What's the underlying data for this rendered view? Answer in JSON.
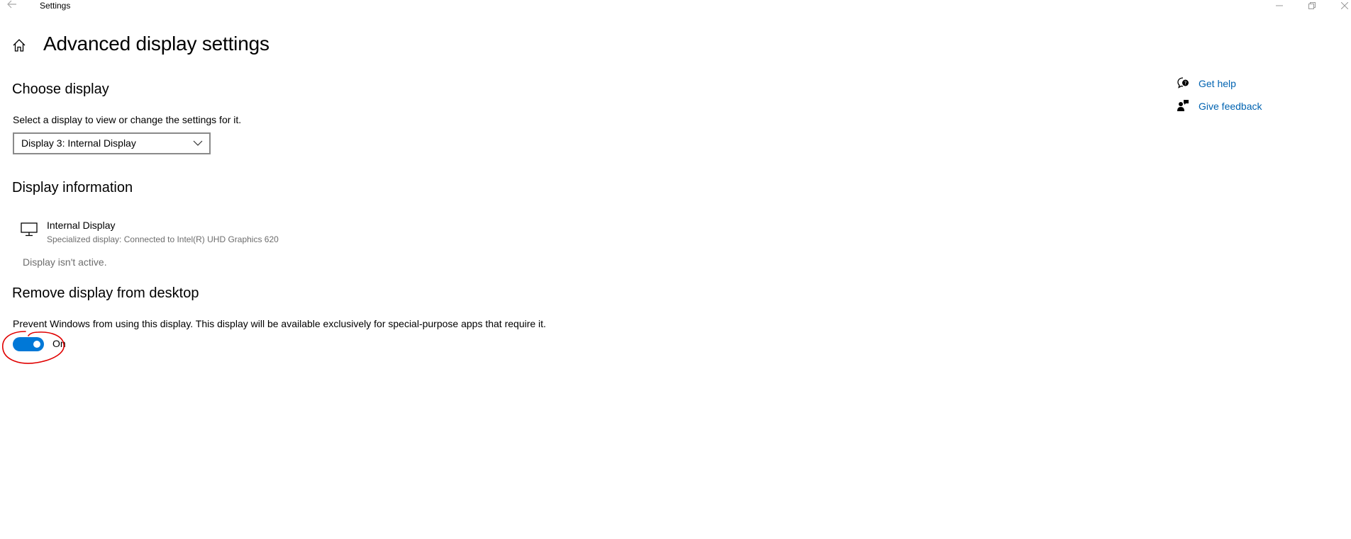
{
  "window": {
    "title": "Settings"
  },
  "page": {
    "title": "Advanced display settings"
  },
  "choose_display": {
    "heading": "Choose display",
    "description": "Select a display to view or change the settings for it.",
    "selected": "Display 3: Internal Display"
  },
  "display_information": {
    "heading": "Display information",
    "name": "Internal Display",
    "details": "Specialized display: Connected to Intel(R) UHD Graphics 620",
    "status": "Display isn't active."
  },
  "remove_display": {
    "heading": "Remove display from desktop",
    "description": "Prevent Windows from using this display. This display will be available exclusively for special-purpose apps that require it.",
    "toggle_state": "On",
    "toggle_on": true
  },
  "help": {
    "get_help": "Get help",
    "give_feedback": "Give feedback"
  },
  "colors": {
    "accent": "#0078d7",
    "link": "#0063b1",
    "annotation": "#e00000"
  },
  "icons": {
    "back": "back-arrow-icon",
    "home": "home-icon",
    "monitor": "monitor-icon",
    "get_help": "help-chat-icon",
    "feedback": "feedback-person-icon"
  }
}
